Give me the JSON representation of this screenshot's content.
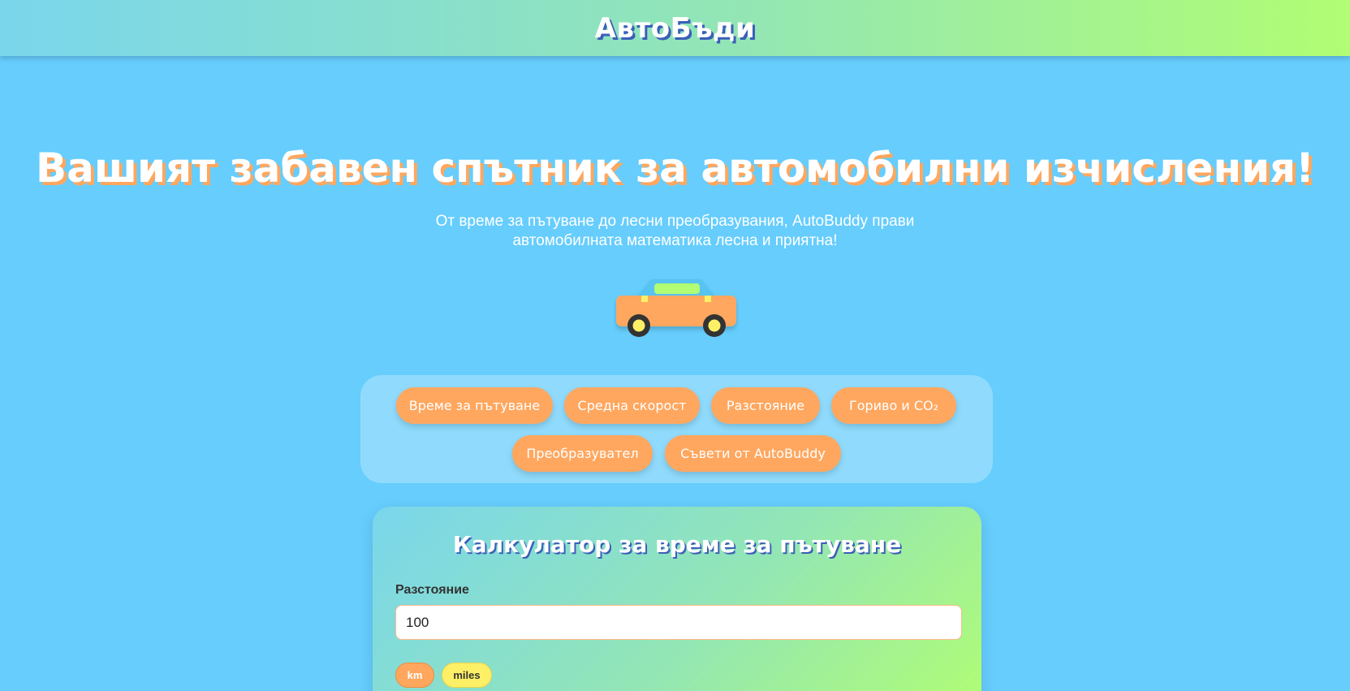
{
  "header": {
    "brand": "АвтоБъди"
  },
  "hero": {
    "title": "Вашият забавен спътник за автомобилни изчисления!",
    "subtitle_line1": "От време за пътуване до лесни преобразувания, AutoBuddy прави",
    "subtitle_line2": "автомобилната математика лесна и приятна!"
  },
  "nav": {
    "items": [
      {
        "label": "Време за пътуване"
      },
      {
        "label": "Средна скорост"
      },
      {
        "label": "Разстояние"
      },
      {
        "label": "Гориво и CO₂"
      },
      {
        "label": "Преобразувател"
      },
      {
        "label": "Съвети от AutoBuddy"
      }
    ]
  },
  "calculator": {
    "title": "Калкулатор за време за пътуване",
    "distance_label": "Разстояние",
    "distance_value": "100",
    "units": [
      {
        "label": "km",
        "selected": true
      },
      {
        "label": "miles",
        "selected": false
      }
    ]
  },
  "colors": {
    "background": "#66cdfd",
    "accent_orange": "#ffa75f",
    "accent_yellow": "#fdf067",
    "accent_green": "#b1fd73"
  }
}
